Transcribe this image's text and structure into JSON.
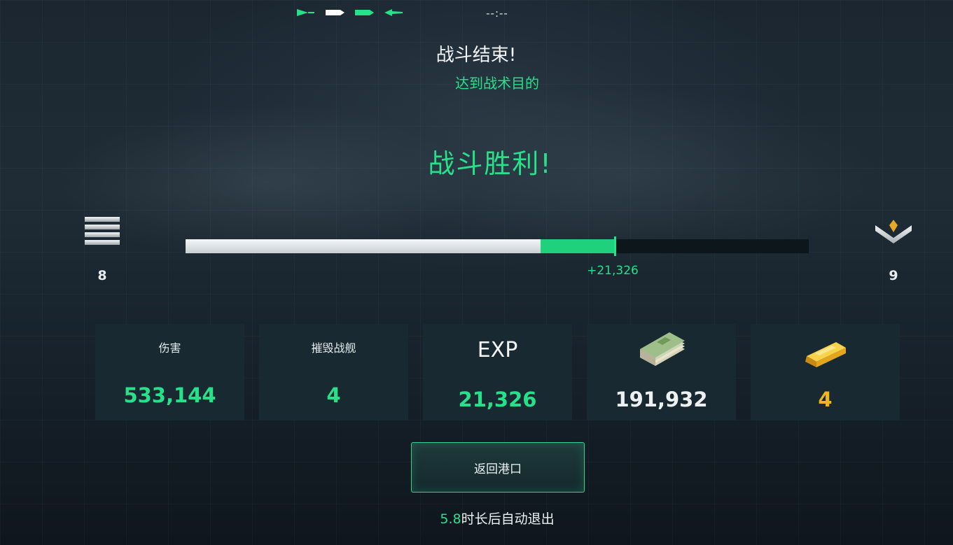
{
  "top_bar": {
    "team_markers": [
      {
        "icon": "green-ship-marker-icon",
        "color": "#26e08a"
      },
      {
        "icon": "white-ship-marker-icon",
        "color": "#ffffff"
      },
      {
        "icon": "green-ship-marker-icon",
        "color": "#26e08a"
      },
      {
        "icon": "green-plane-marker-icon",
        "color": "#26e08a"
      }
    ],
    "timer": "--:--"
  },
  "result": {
    "title": "战斗结束!",
    "subtitle": "达到战术目的",
    "outcome": "战斗胜利!"
  },
  "rank_progress": {
    "current_level": "8",
    "next_level": "9",
    "current_icon": "silver-stripes-rank-icon",
    "next_icon": "chevron-gem-rank-icon",
    "progress_before": 0.57,
    "progress_after": 0.69,
    "gain_text": "+21,326"
  },
  "stats": [
    {
      "label": "伤害",
      "value": "533,144",
      "color": "green"
    },
    {
      "label": "摧毁战舰",
      "value": "4",
      "color": "green"
    },
    {
      "label": "EXP",
      "value": "21,326",
      "color": "green"
    },
    {
      "icon": "cash-stack-icon",
      "value": "191,932",
      "color": "white"
    },
    {
      "icon": "gold-bar-icon",
      "value": "4",
      "color": "gold"
    }
  ],
  "actions": {
    "return_label": "返回港口"
  },
  "auto_exit": {
    "seconds": "5.8",
    "text": "时长后自动退出"
  },
  "colors": {
    "accent_green": "#26e08a",
    "gold": "#f0b51b",
    "card_bg": "#1a2a32"
  }
}
